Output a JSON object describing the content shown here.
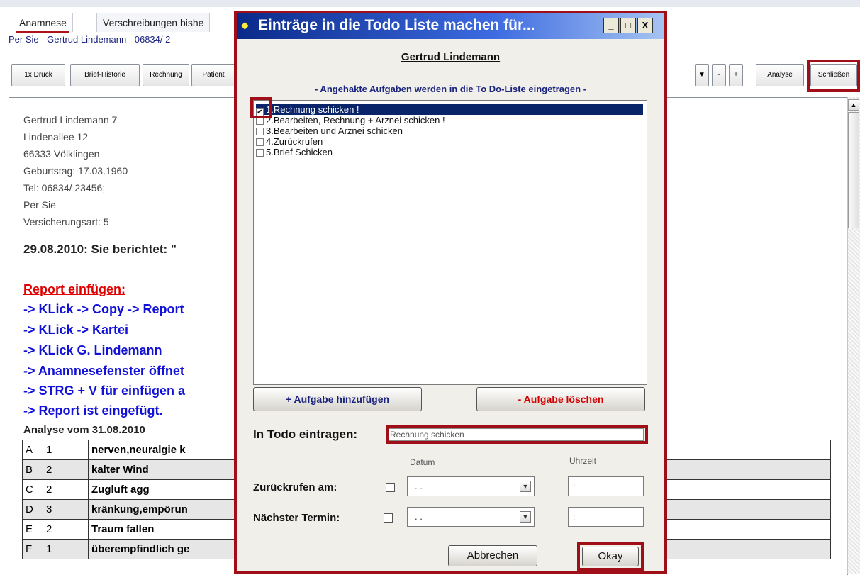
{
  "tabs": [
    "Anamnese",
    "Verschreibungen bishe"
  ],
  "patient_line": "Per Sie - Gertrud Lindemann - 06834/ 2",
  "toolbar": {
    "buttons_left": [
      "1x Druck",
      "Brief-Historie",
      "Rechnung",
      "Patient"
    ],
    "buttons_right": [
      "-",
      "+",
      "Analyse",
      "Schließen"
    ]
  },
  "address": [
    "Gertrud Lindemann 7",
    "Lindenallee 12",
    "66333 Völklingen",
    "Geburtstag: 17.03.1960",
    "Tel: 06834/ 23456;",
    "Per Sie",
    "Versicherungsart: 5"
  ],
  "headline": "29.08.2010: Sie berichtet: \"",
  "report": {
    "title": "Report einfügen:",
    "steps": [
      "-> KLick -> Copy -> Report",
      "-> KLick -> Kartei",
      "-> KLick G. Lindemann",
      "-> Anamnesefenster öffnet",
      "-> STRG + V für einfügen a",
      "-> Report ist eingefügt."
    ]
  },
  "analysis": {
    "title": "Analyse vom 31.08.2010",
    "rows": [
      [
        "A",
        "1",
        "nerven,neuralgie k"
      ],
      [
        "B",
        "2",
        "kalter Wind"
      ],
      [
        "C",
        "2",
        "Zugluft agg"
      ],
      [
        "D",
        "3",
        "kränkung,empörun"
      ],
      [
        "E",
        "2",
        "Traum fallen"
      ],
      [
        "F",
        "1",
        "überempfindlich ge"
      ]
    ]
  },
  "dialog": {
    "title": "Einträge in die Todo Liste machen für...",
    "window_buttons": [
      "_",
      "□",
      "X"
    ],
    "patient_name": "Gertrud Lindemann",
    "hint": "- Angehakte Aufgaben werden in die To Do-Liste eingetragen -",
    "tasks": [
      {
        "label": "1.Rechnung schicken !",
        "checked": true,
        "selected": true
      },
      {
        "label": "2.Bearbeiten, Rechnung + Arznei schicken !",
        "checked": false,
        "selected": false
      },
      {
        "label": "3.Bearbeiten und Arznei schicken",
        "checked": false,
        "selected": false
      },
      {
        "label": "4.Zurückrufen",
        "checked": false,
        "selected": false
      },
      {
        "label": "5.Brief Schicken",
        "checked": false,
        "selected": false
      }
    ],
    "add_button": "+ Aufgabe hinzufügen",
    "delete_button": "- Aufgabe löschen",
    "todo_label": "In Todo eintragen:",
    "todo_value": "Rechnung schicken",
    "date_header": "Datum",
    "time_header": "Uhrzeit",
    "callback_label": "Zurückrufen am:",
    "next_label": "Nächster Termin:",
    "date_value": " .  .",
    "time_value": ":",
    "cancel_button": "Abbrechen",
    "ok_button": "Okay"
  },
  "colors": {
    "highlight": "#a00f18",
    "title_bar": "#0a2a8a",
    "link_blue": "#1111d8",
    "report_red": "#e00000"
  },
  "icons": {
    "scroll_up": "▲",
    "dropdown": "▼",
    "check": "✔",
    "app": "◆"
  }
}
